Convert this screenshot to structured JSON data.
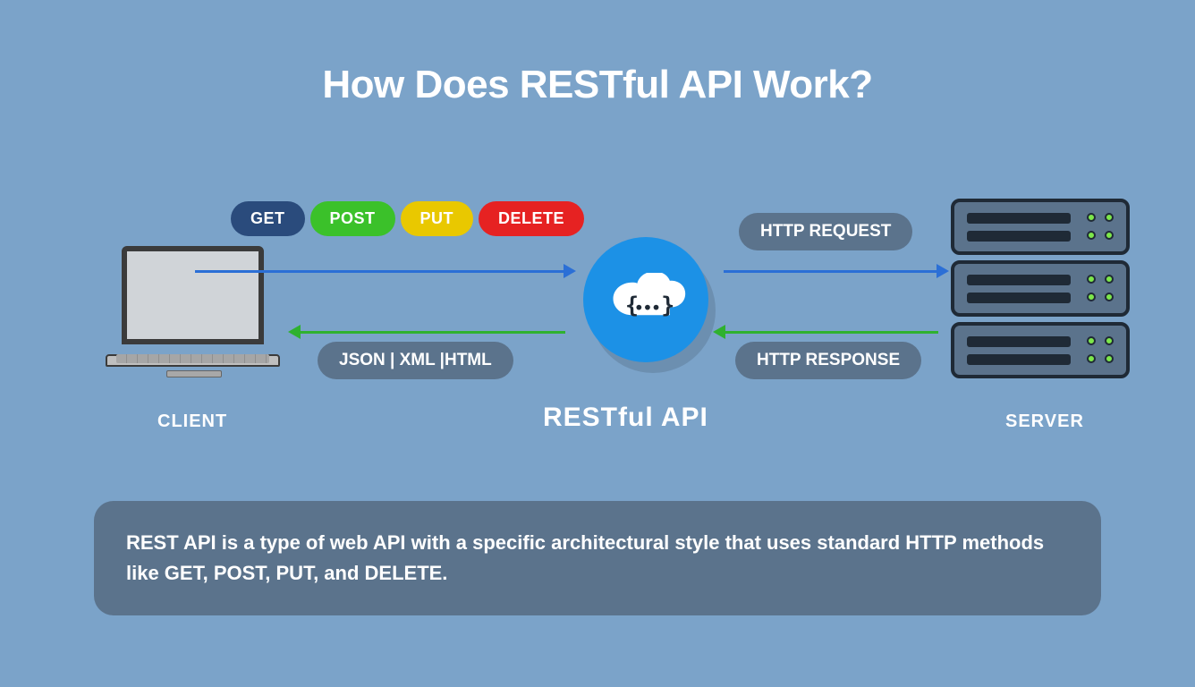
{
  "title": "How Does RESTful API Work?",
  "methods": {
    "get": "GET",
    "post": "POST",
    "put": "PUT",
    "delete": "DELETE"
  },
  "arrows": {
    "request_label": "HTTP REQUEST",
    "response_label": "HTTP RESPONSE",
    "formats_label": "JSON | XML |HTML"
  },
  "nodes": {
    "client": "CLIENT",
    "api": "RESTful API",
    "server": "SERVER"
  },
  "description": "REST API is a type of web API with a specific architectural style that uses standard HTTP methods like GET, POST, PUT, and DELETE.",
  "colors": {
    "background": "#7ba3c9",
    "pill_bg": "#5b738c",
    "get": "#2a4b7c",
    "post": "#3bc12a",
    "put": "#e9c800",
    "delete": "#e62222",
    "arrow_request": "#2b6fd6",
    "arrow_response": "#2fb12f",
    "api_circle": "#1c91e6"
  }
}
